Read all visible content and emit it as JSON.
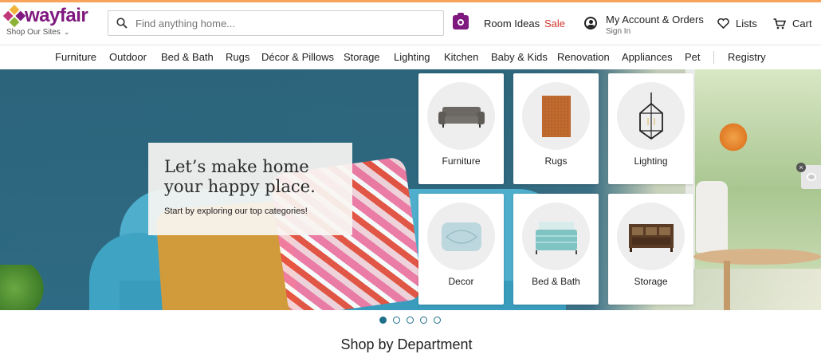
{
  "brand": {
    "name": "wayfair",
    "shop_sites": "Shop Our Sites",
    "color": "#7f187f"
  },
  "search": {
    "placeholder": "Find anything home..."
  },
  "header": {
    "room_ideas": "Room Ideas",
    "sale": "Sale",
    "account_main": "My Account & Orders",
    "account_sub": "Sign In",
    "lists": "Lists",
    "cart": "Cart"
  },
  "nav": {
    "items": [
      {
        "label": "Furniture"
      },
      {
        "label": "Outdoor"
      },
      {
        "label": "Bed & Bath"
      },
      {
        "label": "Rugs"
      },
      {
        "label": "Décor & Pillows"
      },
      {
        "label": "Storage"
      },
      {
        "label": "Lighting"
      },
      {
        "label": "Kitchen"
      },
      {
        "label": "Baby & Kids"
      },
      {
        "label": "Renovation"
      },
      {
        "label": "Appliances"
      },
      {
        "label": "Pet"
      },
      {
        "label": "Registry"
      }
    ]
  },
  "hero": {
    "headline_line1": "Let’s make home",
    "headline_line2": "your happy place.",
    "subtext": "Start by exploring our top categories!",
    "categories": [
      {
        "label": "Furniture",
        "icon": "sofa-icon"
      },
      {
        "label": "Rugs",
        "icon": "rug-icon"
      },
      {
        "label": "Lighting",
        "icon": "lantern-icon"
      },
      {
        "label": "Decor",
        "icon": "pillow-icon"
      },
      {
        "label": "Bed & Bath",
        "icon": "bed-icon"
      },
      {
        "label": "Storage",
        "icon": "storage-cabinet-icon"
      }
    ]
  },
  "carousel": {
    "slides": 5,
    "active": 1
  },
  "section": {
    "title": "Shop by Department"
  },
  "colors": {
    "sale": "#d0362f",
    "accent": "#1f6f8b",
    "topline": "#f7a35c"
  }
}
